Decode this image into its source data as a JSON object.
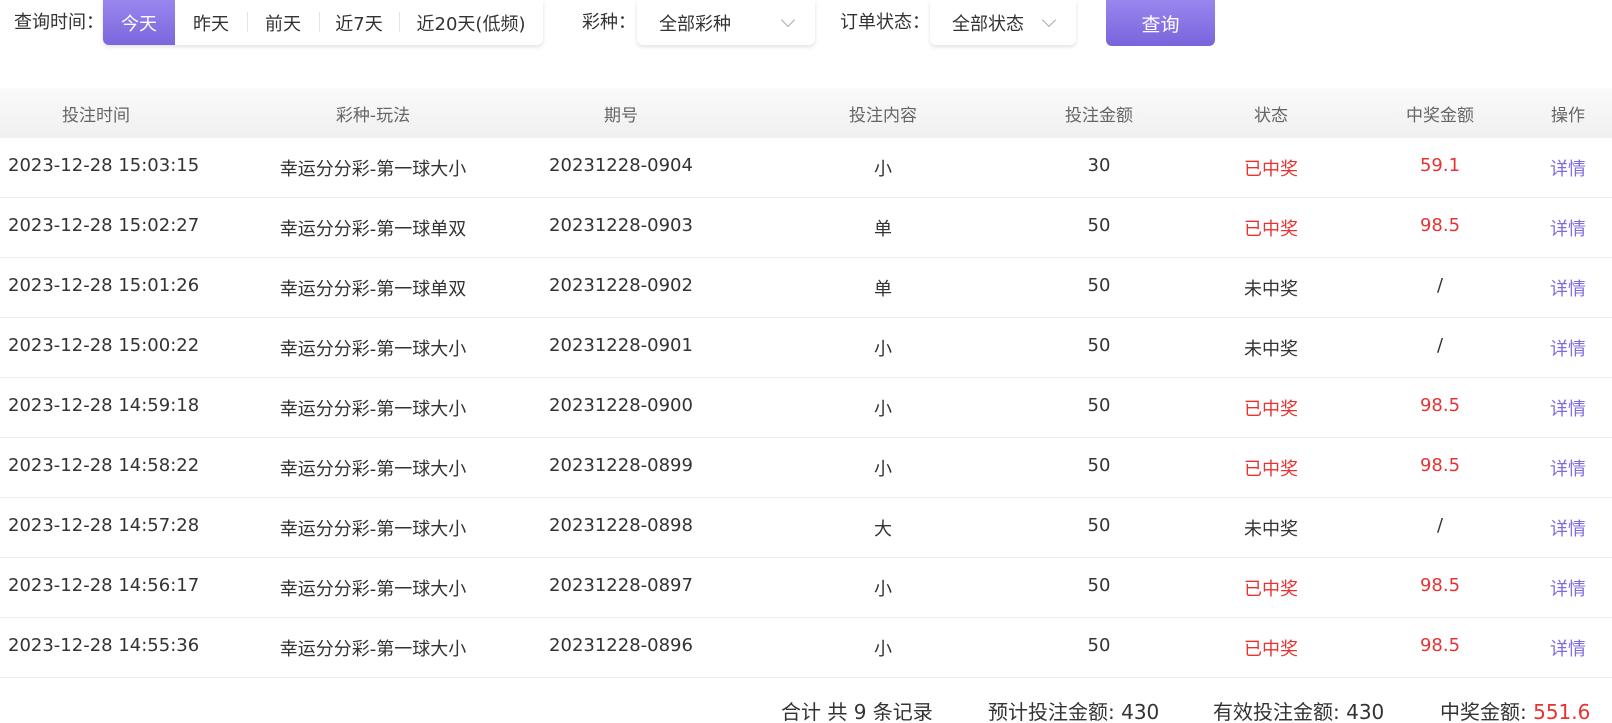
{
  "filters": {
    "time_label": "查询时间：",
    "time_options": [
      "今天",
      "昨天",
      "前天",
      "近7天",
      "近20天(低频)"
    ],
    "time_selected": "今天",
    "lottery_label": "彩种：",
    "lottery_value": "全部彩种",
    "status_label": "订单状态：",
    "status_value": "全部状态",
    "query_label": "查询"
  },
  "table": {
    "columns": [
      "投注时间",
      "彩种-玩法",
      "期号",
      "投注内容",
      "投注金额",
      "状态",
      "中奖金额",
      "操作"
    ],
    "rows": [
      {
        "time": "2023-12-28 15:03:15",
        "game": "幸运分分彩-第一球大小",
        "issue": "20231228-0904",
        "content": "小",
        "amount": "30",
        "status": "已中奖",
        "prize": "59.1",
        "action": "详情",
        "won": true
      },
      {
        "time": "2023-12-28 15:02:27",
        "game": "幸运分分彩-第一球单双",
        "issue": "20231228-0903",
        "content": "单",
        "amount": "50",
        "status": "已中奖",
        "prize": "98.5",
        "action": "详情",
        "won": true
      },
      {
        "time": "2023-12-28 15:01:26",
        "game": "幸运分分彩-第一球单双",
        "issue": "20231228-0902",
        "content": "单",
        "amount": "50",
        "status": "未中奖",
        "prize": "/",
        "action": "详情",
        "won": false
      },
      {
        "time": "2023-12-28 15:00:22",
        "game": "幸运分分彩-第一球大小",
        "issue": "20231228-0901",
        "content": "小",
        "amount": "50",
        "status": "未中奖",
        "prize": "/",
        "action": "详情",
        "won": false
      },
      {
        "time": "2023-12-28 14:59:18",
        "game": "幸运分分彩-第一球大小",
        "issue": "20231228-0900",
        "content": "小",
        "amount": "50",
        "status": "已中奖",
        "prize": "98.5",
        "action": "详情",
        "won": true
      },
      {
        "time": "2023-12-28 14:58:22",
        "game": "幸运分分彩-第一球大小",
        "issue": "20231228-0899",
        "content": "小",
        "amount": "50",
        "status": "已中奖",
        "prize": "98.5",
        "action": "详情",
        "won": true
      },
      {
        "time": "2023-12-28 14:57:28",
        "game": "幸运分分彩-第一球大小",
        "issue": "20231228-0898",
        "content": "大",
        "amount": "50",
        "status": "未中奖",
        "prize": "/",
        "action": "详情",
        "won": false
      },
      {
        "time": "2023-12-28 14:56:17",
        "game": "幸运分分彩-第一球大小",
        "issue": "20231228-0897",
        "content": "小",
        "amount": "50",
        "status": "已中奖",
        "prize": "98.5",
        "action": "详情",
        "won": true
      },
      {
        "time": "2023-12-28 14:55:36",
        "game": "幸运分分彩-第一球大小",
        "issue": "20231228-0896",
        "content": "小",
        "amount": "50",
        "status": "已中奖",
        "prize": "98.5",
        "action": "详情",
        "won": true
      }
    ]
  },
  "summary": {
    "total_records": "合计 共 9 条记录",
    "expected_label": "预计投注金额: ",
    "expected_value": "430",
    "valid_label": "有效投注金额: ",
    "valid_value": "430",
    "prize_label": "中奖金额: ",
    "prize_value": "551.6"
  },
  "colors": {
    "accent": "#7f6be0",
    "win": "#e83232"
  }
}
